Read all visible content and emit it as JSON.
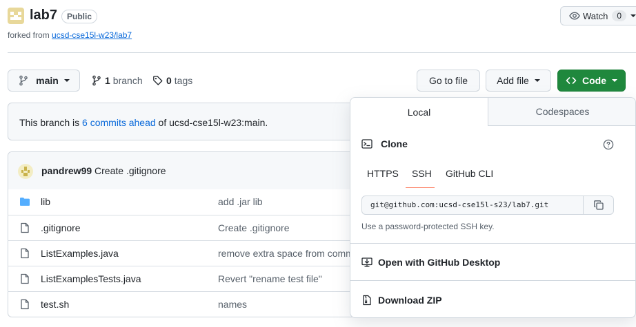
{
  "repo": {
    "name": "lab7",
    "visibility": "Public",
    "forked_prefix": "forked from",
    "forked_source": "ucsd-cse15l-w23/lab7"
  },
  "watch": {
    "label": "Watch",
    "count": "0"
  },
  "branch_bar": {
    "branch": "main",
    "branches_count": "1",
    "branches_label": "branch",
    "tags_count": "0",
    "tags_label": "tags",
    "go_to_file": "Go to file",
    "add_file": "Add file",
    "code": "Code"
  },
  "ahead_notice": {
    "prefix": "This branch is",
    "link": "6 commits ahead",
    "suffix": "of ucsd-cse15l-w23:main."
  },
  "latest_commit": {
    "author": "pandrew99",
    "message": "Create .gitignore"
  },
  "files": [
    {
      "name": "lib",
      "type": "folder",
      "message": "add .jar lib"
    },
    {
      "name": ".gitignore",
      "type": "file",
      "message": "Create .gitignore"
    },
    {
      "name": "ListExamples.java",
      "type": "file",
      "message": "remove extra space from comm"
    },
    {
      "name": "ListExamplesTests.java",
      "type": "file",
      "message": "Revert \"rename test file\""
    },
    {
      "name": "test.sh",
      "type": "file",
      "message": "names"
    }
  ],
  "code_dropdown": {
    "tabs": [
      "Local",
      "Codespaces"
    ],
    "clone_label": "Clone",
    "protocols": [
      "HTTPS",
      "SSH",
      "GitHub CLI"
    ],
    "selected_protocol": "SSH",
    "clone_url": "git@github.com:ucsd-cse15l-s23/lab7.git",
    "hint": "Use a password-protected SSH key.",
    "open_desktop": "Open with GitHub Desktop",
    "download_zip": "Download ZIP"
  },
  "colors": {
    "accent": "#0969da",
    "code_button": "#1f883d",
    "tab_underline": "#fd8c73"
  }
}
